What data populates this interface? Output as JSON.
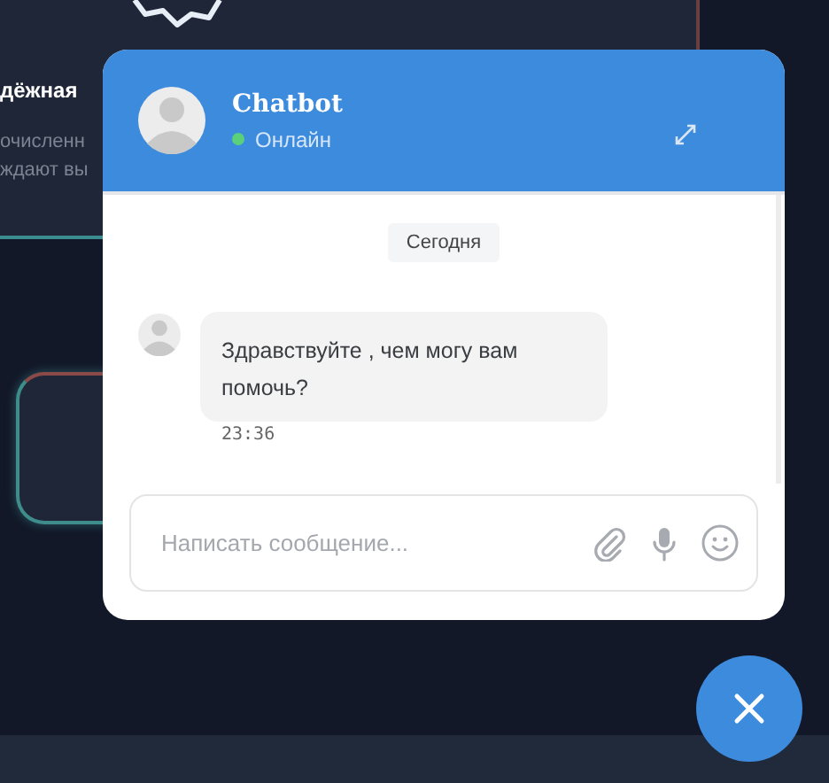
{
  "background": {
    "heading": "дёжная",
    "lines": [
      "очисленн",
      "ждают вы"
    ]
  },
  "chat": {
    "title": "Chatbot",
    "status": {
      "label": "Онлайн",
      "online": true
    },
    "date_divider": "Сегодня",
    "messages": [
      {
        "text": "Здравствуйте , чем могу вам помочь?",
        "time": "23:36"
      }
    ],
    "composer": {
      "placeholder": "Написать сообщение..."
    }
  }
}
